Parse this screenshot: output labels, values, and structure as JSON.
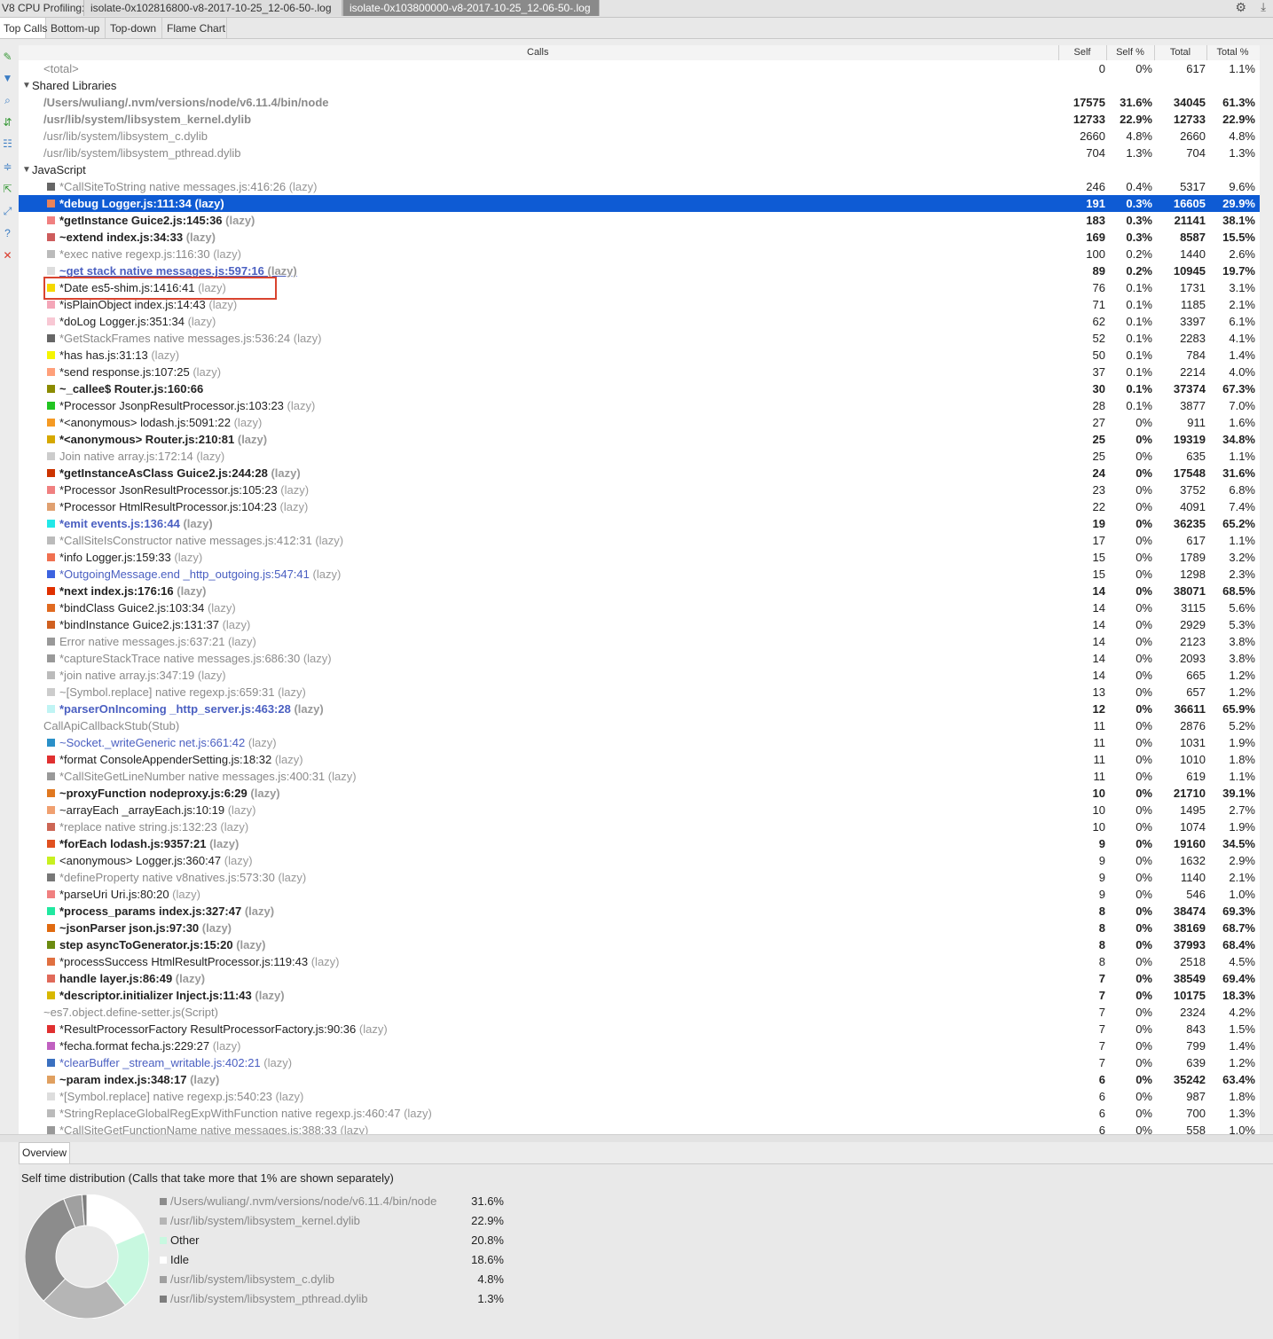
{
  "app": {
    "title": "V8 CPU Profiling:"
  },
  "files": [
    "isolate-0x102816800-v8-2017-10-25_12-06-50-.log",
    "isolate-0x103800000-v8-2017-10-25_12-06-50-.log"
  ],
  "view_tabs": [
    "Top Calls",
    "Bottom-up",
    "Top-down",
    "Flame Chart"
  ],
  "columns": {
    "calls": "Calls",
    "self": "Self",
    "self_pct": "Self %",
    "total": "Total",
    "total_pct": "Total %"
  },
  "rows": [
    {
      "name": "<total>",
      "lazy": "",
      "self": "0",
      "self_pct": "0%",
      "total": "617",
      "total_pct": "1.1%",
      "style": "grey",
      "indent": 1,
      "color": ""
    },
    {
      "name": "Shared Libraries",
      "lazy": "",
      "self": "",
      "self_pct": "",
      "total": "",
      "total_pct": "",
      "style": "group",
      "indent": 0,
      "color": ""
    },
    {
      "name": "/Users/wuliang/.nvm/versions/node/v6.11.4/bin/node",
      "lazy": "",
      "self": "17575",
      "self_pct": "31.6%",
      "total": "34045",
      "total_pct": "61.3%",
      "style": "bold grey",
      "indent": 1,
      "color": ""
    },
    {
      "name": "/usr/lib/system/libsystem_kernel.dylib",
      "lazy": "",
      "self": "12733",
      "self_pct": "22.9%",
      "total": "12733",
      "total_pct": "22.9%",
      "style": "bold grey",
      "indent": 1,
      "color": ""
    },
    {
      "name": "/usr/lib/system/libsystem_c.dylib",
      "lazy": "",
      "self": "2660",
      "self_pct": "4.8%",
      "total": "2660",
      "total_pct": "4.8%",
      "style": "grey",
      "indent": 1,
      "color": ""
    },
    {
      "name": "/usr/lib/system/libsystem_pthread.dylib",
      "lazy": "",
      "self": "704",
      "self_pct": "1.3%",
      "total": "704",
      "total_pct": "1.3%",
      "style": "grey",
      "indent": 1,
      "color": ""
    },
    {
      "name": "JavaScript",
      "lazy": "",
      "self": "",
      "self_pct": "",
      "total": "",
      "total_pct": "",
      "style": "group",
      "indent": 0,
      "color": ""
    },
    {
      "name": "*CallSiteToString native messages.js:416:26",
      "lazy": "(lazy)",
      "self": "246",
      "self_pct": "0.4%",
      "total": "5317",
      "total_pct": "9.6%",
      "style": "grey",
      "indent": 2,
      "color": "#666666"
    },
    {
      "name": "*debug Logger.js:111:34",
      "lazy": "(lazy)",
      "self": "191",
      "self_pct": "0.3%",
      "total": "16605",
      "total_pct": "29.9%",
      "style": "bold sel",
      "indent": 2,
      "color": "#e8835a"
    },
    {
      "name": "*getInstance Guice2.js:145:36",
      "lazy": "(lazy)",
      "self": "183",
      "self_pct": "0.3%",
      "total": "21141",
      "total_pct": "38.1%",
      "style": "bold",
      "indent": 2,
      "color": "#f08080"
    },
    {
      "name": "~extend index.js:34:33",
      "lazy": "(lazy)",
      "self": "169",
      "self_pct": "0.3%",
      "total": "8587",
      "total_pct": "15.5%",
      "style": "bold",
      "indent": 2,
      "color": "#cd5c5c"
    },
    {
      "name": "*exec native regexp.js:116:30",
      "lazy": "(lazy)",
      "self": "100",
      "self_pct": "0.2%",
      "total": "1440",
      "total_pct": "2.6%",
      "style": "grey",
      "indent": 2,
      "color": "#bbbbbb"
    },
    {
      "name": "~get stack native messages.js:597:16",
      "lazy": "(lazy)",
      "self": "89",
      "self_pct": "0.2%",
      "total": "10945",
      "total_pct": "19.7%",
      "style": "bold link under",
      "indent": 2,
      "color": "#dddddd"
    },
    {
      "name": "*Date es5-shim.js:1416:41",
      "lazy": "(lazy)",
      "self": "76",
      "self_pct": "0.1%",
      "total": "1731",
      "total_pct": "3.1%",
      "style": "",
      "indent": 2,
      "color": "#f5d800"
    },
    {
      "name": "*isPlainObject index.js:14:43",
      "lazy": "(lazy)",
      "self": "71",
      "self_pct": "0.1%",
      "total": "1185",
      "total_pct": "2.1%",
      "style": "",
      "indent": 2,
      "color": "#f4a6b8"
    },
    {
      "name": "*doLog Logger.js:351:34",
      "lazy": "(lazy)",
      "self": "62",
      "self_pct": "0.1%",
      "total": "3397",
      "total_pct": "6.1%",
      "style": "",
      "indent": 2,
      "color": "#f8c8d4"
    },
    {
      "name": "*GetStackFrames native messages.js:536:24",
      "lazy": "(lazy)",
      "self": "52",
      "self_pct": "0.1%",
      "total": "2283",
      "total_pct": "4.1%",
      "style": "grey",
      "indent": 2,
      "color": "#666666"
    },
    {
      "name": "*has has.js:31:13",
      "lazy": "(lazy)",
      "self": "50",
      "self_pct": "0.1%",
      "total": "784",
      "total_pct": "1.4%",
      "style": "",
      "indent": 2,
      "color": "#f5f500"
    },
    {
      "name": "*send response.js:107:25",
      "lazy": "(lazy)",
      "self": "37",
      "self_pct": "0.1%",
      "total": "2214",
      "total_pct": "4.0%",
      "style": "",
      "indent": 2,
      "color": "#ffa07a"
    },
    {
      "name": "~_callee$ Router.js:160:66",
      "lazy": "",
      "self": "30",
      "self_pct": "0.1%",
      "total": "37374",
      "total_pct": "67.3%",
      "style": "bold",
      "indent": 2,
      "color": "#8b8b00"
    },
    {
      "name": "*Processor JsonpResultProcessor.js:103:23",
      "lazy": "(lazy)",
      "self": "28",
      "self_pct": "0.1%",
      "total": "3877",
      "total_pct": "7.0%",
      "style": "",
      "indent": 2,
      "color": "#22c422"
    },
    {
      "name": "*<anonymous> lodash.js:5091:22",
      "lazy": "(lazy)",
      "self": "27",
      "self_pct": "0%",
      "total": "911",
      "total_pct": "1.6%",
      "style": "",
      "indent": 2,
      "color": "#f59a23"
    },
    {
      "name": "*<anonymous> Router.js:210:81",
      "lazy": "(lazy)",
      "self": "25",
      "self_pct": "0%",
      "total": "19319",
      "total_pct": "34.8%",
      "style": "bold",
      "indent": 2,
      "color": "#d6a800"
    },
    {
      "name": "Join native array.js:172:14",
      "lazy": "(lazy)",
      "self": "25",
      "self_pct": "0%",
      "total": "635",
      "total_pct": "1.1%",
      "style": "grey",
      "indent": 2,
      "color": "#cccccc"
    },
    {
      "name": "*getInstanceAsClass Guice2.js:244:28",
      "lazy": "(lazy)",
      "self": "24",
      "self_pct": "0%",
      "total": "17548",
      "total_pct": "31.6%",
      "style": "bold",
      "indent": 2,
      "color": "#cc3300"
    },
    {
      "name": "*Processor JsonResultProcessor.js:105:23",
      "lazy": "(lazy)",
      "self": "23",
      "self_pct": "0%",
      "total": "3752",
      "total_pct": "6.8%",
      "style": "",
      "indent": 2,
      "color": "#f08080"
    },
    {
      "name": "*Processor HtmlResultProcessor.js:104:23",
      "lazy": "(lazy)",
      "self": "22",
      "self_pct": "0%",
      "total": "4091",
      "total_pct": "7.4%",
      "style": "",
      "indent": 2,
      "color": "#e0a070"
    },
    {
      "name": "*emit events.js:136:44",
      "lazy": "(lazy)",
      "self": "19",
      "self_pct": "0%",
      "total": "36235",
      "total_pct": "65.2%",
      "style": "bold link",
      "indent": 2,
      "color": "#22e8e8"
    },
    {
      "name": "*CallSiteIsConstructor native messages.js:412:31",
      "lazy": "(lazy)",
      "self": "17",
      "self_pct": "0%",
      "total": "617",
      "total_pct": "1.1%",
      "style": "grey",
      "indent": 2,
      "color": "#bbbbbb"
    },
    {
      "name": "*info Logger.js:159:33",
      "lazy": "(lazy)",
      "self": "15",
      "self_pct": "0%",
      "total": "1789",
      "total_pct": "3.2%",
      "style": "",
      "indent": 2,
      "color": "#f07050"
    },
    {
      "name": "*OutgoingMessage.end _http_outgoing.js:547:41",
      "lazy": "(lazy)",
      "self": "15",
      "self_pct": "0%",
      "total": "1298",
      "total_pct": "2.3%",
      "style": "link",
      "indent": 2,
      "color": "#3c63e0"
    },
    {
      "name": "*next index.js:176:16",
      "lazy": "(lazy)",
      "self": "14",
      "self_pct": "0%",
      "total": "38071",
      "total_pct": "68.5%",
      "style": "bold",
      "indent": 2,
      "color": "#e03000"
    },
    {
      "name": "*bindClass Guice2.js:103:34",
      "lazy": "(lazy)",
      "self": "14",
      "self_pct": "0%",
      "total": "3115",
      "total_pct": "5.6%",
      "style": "",
      "indent": 2,
      "color": "#e06a20"
    },
    {
      "name": "*bindInstance Guice2.js:131:37",
      "lazy": "(lazy)",
      "self": "14",
      "self_pct": "0%",
      "total": "2929",
      "total_pct": "5.3%",
      "style": "",
      "indent": 2,
      "color": "#d06020"
    },
    {
      "name": "Error native messages.js:637:21",
      "lazy": "(lazy)",
      "self": "14",
      "self_pct": "0%",
      "total": "2123",
      "total_pct": "3.8%",
      "style": "grey",
      "indent": 2,
      "color": "#999999"
    },
    {
      "name": "*captureStackTrace native messages.js:686:30",
      "lazy": "(lazy)",
      "self": "14",
      "self_pct": "0%",
      "total": "2093",
      "total_pct": "3.8%",
      "style": "grey",
      "indent": 2,
      "color": "#999999"
    },
    {
      "name": "*join native array.js:347:19",
      "lazy": "(lazy)",
      "self": "14",
      "self_pct": "0%",
      "total": "665",
      "total_pct": "1.2%",
      "style": "grey",
      "indent": 2,
      "color": "#bbbbbb"
    },
    {
      "name": "~[Symbol.replace] native regexp.js:659:31",
      "lazy": "(lazy)",
      "self": "13",
      "self_pct": "0%",
      "total": "657",
      "total_pct": "1.2%",
      "style": "grey",
      "indent": 2,
      "color": "#cccccc"
    },
    {
      "name": "*parserOnIncoming _http_server.js:463:28",
      "lazy": "(lazy)",
      "self": "12",
      "self_pct": "0%",
      "total": "36611",
      "total_pct": "65.9%",
      "style": "bold link",
      "indent": 2,
      "color": "#c0f4f4"
    },
    {
      "name": "CallApiCallbackStub(Stub)",
      "lazy": "",
      "self": "11",
      "self_pct": "0%",
      "total": "2876",
      "total_pct": "5.2%",
      "style": "grey",
      "indent": 1,
      "color": ""
    },
    {
      "name": "~Socket._writeGeneric net.js:661:42",
      "lazy": "(lazy)",
      "self": "11",
      "self_pct": "0%",
      "total": "1031",
      "total_pct": "1.9%",
      "style": "link",
      "indent": 2,
      "color": "#2a90c8"
    },
    {
      "name": "*format ConsoleAppenderSetting.js:18:32",
      "lazy": "(lazy)",
      "self": "11",
      "self_pct": "0%",
      "total": "1010",
      "total_pct": "1.8%",
      "style": "",
      "indent": 2,
      "color": "#e03030"
    },
    {
      "name": "*CallSiteGetLineNumber native messages.js:400:31",
      "lazy": "(lazy)",
      "self": "11",
      "self_pct": "0%",
      "total": "619",
      "total_pct": "1.1%",
      "style": "grey",
      "indent": 2,
      "color": "#999999"
    },
    {
      "name": "~proxyFunction nodeproxy.js:6:29",
      "lazy": "(lazy)",
      "self": "10",
      "self_pct": "0%",
      "total": "21710",
      "total_pct": "39.1%",
      "style": "bold",
      "indent": 2,
      "color": "#e07820"
    },
    {
      "name": "~arrayEach _arrayEach.js:10:19",
      "lazy": "(lazy)",
      "self": "10",
      "self_pct": "0%",
      "total": "1495",
      "total_pct": "2.7%",
      "style": "",
      "indent": 2,
      "color": "#f0a070"
    },
    {
      "name": "*replace native string.js:132:23",
      "lazy": "(lazy)",
      "self": "10",
      "self_pct": "0%",
      "total": "1074",
      "total_pct": "1.9%",
      "style": "grey",
      "indent": 2,
      "color": "#cc6655"
    },
    {
      "name": "*forEach lodash.js:9357:21",
      "lazy": "(lazy)",
      "self": "9",
      "self_pct": "0%",
      "total": "19160",
      "total_pct": "34.5%",
      "style": "bold",
      "indent": 2,
      "color": "#e05020"
    },
    {
      "name": "<anonymous> Logger.js:360:47",
      "lazy": "(lazy)",
      "self": "9",
      "self_pct": "0%",
      "total": "1632",
      "total_pct": "2.9%",
      "style": "",
      "indent": 2,
      "color": "#c8f020"
    },
    {
      "name": "*defineProperty native v8natives.js:573:30",
      "lazy": "(lazy)",
      "self": "9",
      "self_pct": "0%",
      "total": "1140",
      "total_pct": "2.1%",
      "style": "grey",
      "indent": 2,
      "color": "#777777"
    },
    {
      "name": "*parseUri Uri.js:80:20",
      "lazy": "(lazy)",
      "self": "9",
      "self_pct": "0%",
      "total": "546",
      "total_pct": "1.0%",
      "style": "",
      "indent": 2,
      "color": "#f08080"
    },
    {
      "name": "*process_params index.js:327:47",
      "lazy": "(lazy)",
      "self": "8",
      "self_pct": "0%",
      "total": "38474",
      "total_pct": "69.3%",
      "style": "bold",
      "indent": 2,
      "color": "#20e8a0"
    },
    {
      "name": "~jsonParser json.js:97:30",
      "lazy": "(lazy)",
      "self": "8",
      "self_pct": "0%",
      "total": "38169",
      "total_pct": "68.7%",
      "style": "bold",
      "indent": 2,
      "color": "#e06a10"
    },
    {
      "name": "step asyncToGenerator.js:15:20",
      "lazy": "(lazy)",
      "self": "8",
      "self_pct": "0%",
      "total": "37993",
      "total_pct": "68.4%",
      "style": "bold",
      "indent": 2,
      "color": "#6b8b10"
    },
    {
      "name": "*processSuccess HtmlResultProcessor.js:119:43",
      "lazy": "(lazy)",
      "self": "8",
      "self_pct": "0%",
      "total": "2518",
      "total_pct": "4.5%",
      "style": "",
      "indent": 2,
      "color": "#e07040"
    },
    {
      "name": "handle layer.js:86:49",
      "lazy": "(lazy)",
      "self": "7",
      "self_pct": "0%",
      "total": "38549",
      "total_pct": "69.4%",
      "style": "bold",
      "indent": 2,
      "color": "#e06a5a"
    },
    {
      "name": "*descriptor.initializer Inject.js:11:43",
      "lazy": "(lazy)",
      "self": "7",
      "self_pct": "0%",
      "total": "10175",
      "total_pct": "18.3%",
      "style": "bold",
      "indent": 2,
      "color": "#d8b800"
    },
    {
      "name": "~es7.object.define-setter.js(Script)",
      "lazy": "",
      "self": "7",
      "self_pct": "0%",
      "total": "2324",
      "total_pct": "4.2%",
      "style": "grey",
      "indent": 1,
      "color": ""
    },
    {
      "name": "*ResultProcessorFactory ResultProcessorFactory.js:90:36",
      "lazy": "(lazy)",
      "self": "7",
      "self_pct": "0%",
      "total": "843",
      "total_pct": "1.5%",
      "style": "",
      "indent": 2,
      "color": "#e03030"
    },
    {
      "name": "*fecha.format fecha.js:229:27",
      "lazy": "(lazy)",
      "self": "7",
      "self_pct": "0%",
      "total": "799",
      "total_pct": "1.4%",
      "style": "",
      "indent": 2,
      "color": "#c060c0"
    },
    {
      "name": "*clearBuffer _stream_writable.js:402:21",
      "lazy": "(lazy)",
      "self": "7",
      "self_pct": "0%",
      "total": "639",
      "total_pct": "1.2%",
      "style": "link",
      "indent": 2,
      "color": "#3a70c0"
    },
    {
      "name": "~param index.js:348:17",
      "lazy": "(lazy)",
      "self": "6",
      "self_pct": "0%",
      "total": "35242",
      "total_pct": "63.4%",
      "style": "bold",
      "indent": 2,
      "color": "#e0a060"
    },
    {
      "name": "*[Symbol.replace] native regexp.js:540:23",
      "lazy": "(lazy)",
      "self": "6",
      "self_pct": "0%",
      "total": "987",
      "total_pct": "1.8%",
      "style": "grey",
      "indent": 2,
      "color": "#dddddd"
    },
    {
      "name": "*StringReplaceGlobalRegExpWithFunction native regexp.js:460:47",
      "lazy": "(lazy)",
      "self": "6",
      "self_pct": "0%",
      "total": "700",
      "total_pct": "1.3%",
      "style": "grey",
      "indent": 2,
      "color": "#bbbbbb"
    },
    {
      "name": "*CallSiteGetFunctionName native messages.js:388:33",
      "lazy": "(lazy)",
      "self": "6",
      "self_pct": "0%",
      "total": "558",
      "total_pct": "1.0%",
      "style": "grey",
      "indent": 2,
      "color": "#999999"
    }
  ],
  "overview": {
    "tab": "Overview",
    "title": "Self time distribution (Calls that take more that 1% are shown separately)",
    "legend": [
      {
        "name": "/Users/wuliang/.nvm/versions/node/v6.11.4/bin/node",
        "value": "31.6%",
        "pct": 31.6,
        "color": "#8c8c8c"
      },
      {
        "name": "/usr/lib/system/libsystem_kernel.dylib",
        "value": "22.9%",
        "pct": 22.9,
        "color": "#b5b5b5"
      },
      {
        "name": "Other",
        "value": "20.8%",
        "pct": 20.8,
        "color": "#c8f8e0"
      },
      {
        "name": "Idle",
        "value": "18.6%",
        "pct": 18.6,
        "color": "#ffffff"
      },
      {
        "name": "/usr/lib/system/libsystem_c.dylib",
        "value": "4.8%",
        "pct": 4.8,
        "color": "#a0a0a0"
      },
      {
        "name": "/usr/lib/system/libsystem_pthread.dylib",
        "value": "1.3%",
        "pct": 1.3,
        "color": "#7d7d7d"
      }
    ]
  }
}
